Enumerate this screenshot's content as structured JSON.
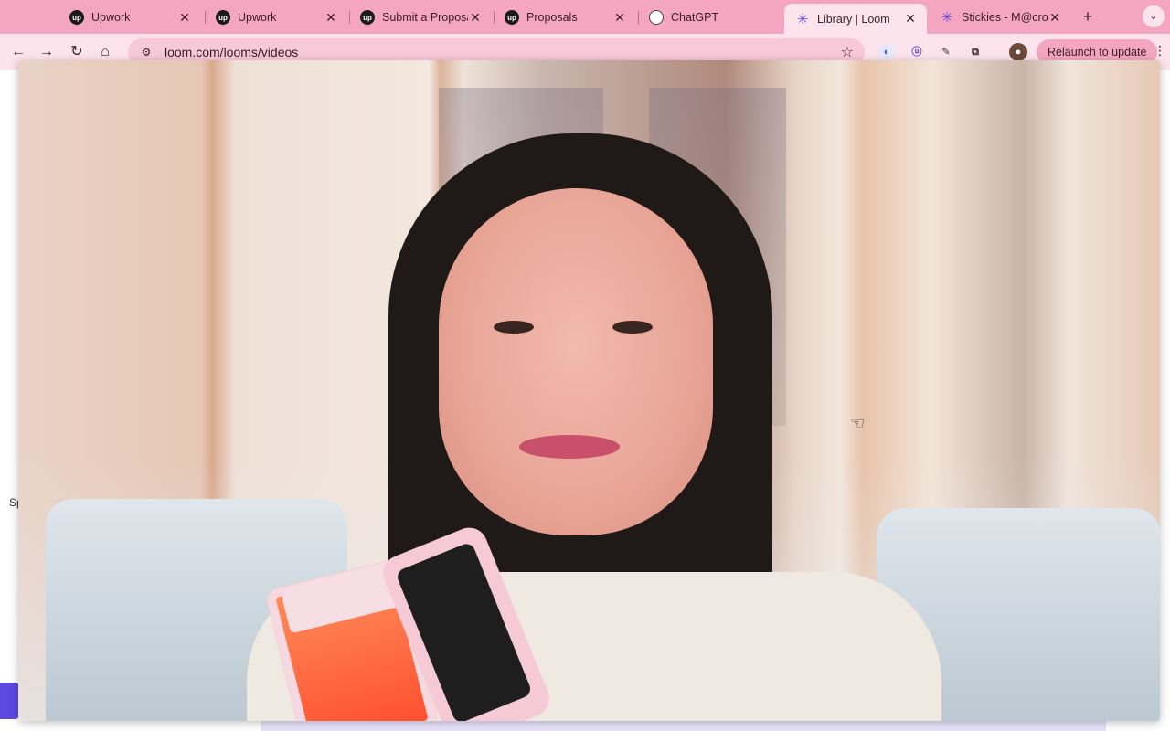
{
  "tabs": [
    {
      "label": "Upwork",
      "favicon": "upwork-icon",
      "active": false
    },
    {
      "label": "Upwork",
      "favicon": "upwork-icon",
      "active": false
    },
    {
      "label": "Submit a Proposal",
      "favicon": "upwork-icon",
      "active": false
    },
    {
      "label": "Proposals",
      "favicon": "upwork-icon",
      "active": false
    },
    {
      "label": "ChatGPT",
      "favicon": "chatgpt-icon",
      "active": false
    },
    {
      "label": "Library | Loom",
      "favicon": "loom-icon",
      "active": true
    },
    {
      "label": "Stickies - M@croh",
      "favicon": "loom-icon",
      "active": false
    }
  ],
  "toolbar": {
    "url": "loom.com/looms/videos",
    "relaunch_label": "Relaunch to update"
  },
  "page": {
    "fragment_sp": "Sp"
  },
  "colors": {
    "tabstrip": "#f4a6c0",
    "toolbar": "#fde3ec",
    "loom_accent": "#5b49e0"
  }
}
